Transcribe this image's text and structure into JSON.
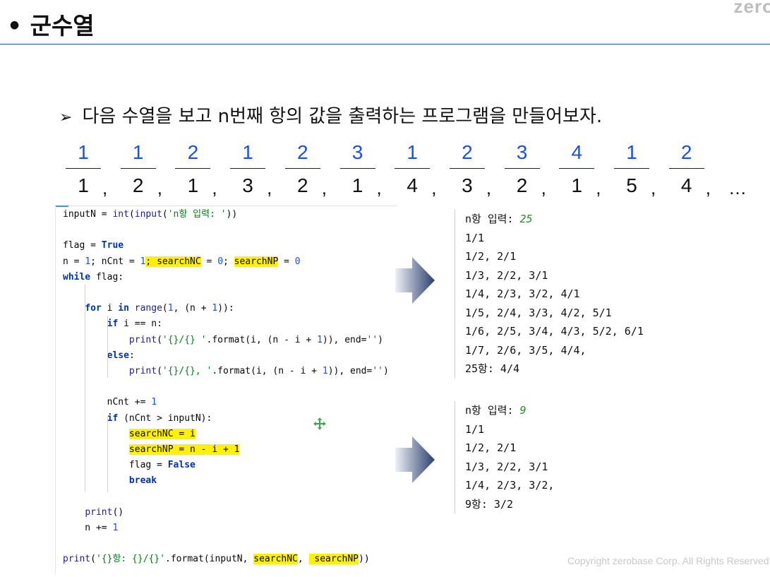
{
  "header": {
    "brand": "zero",
    "title": "• 군수열"
  },
  "bullet": {
    "arrow": "➢",
    "text": "다음 수열을 보고 n번째 항의 값을 출력하는 프로그램을 만들어보자."
  },
  "sequence": {
    "fractions": [
      {
        "num": "1",
        "den": "1"
      },
      {
        "num": "1",
        "den": "2"
      },
      {
        "num": "2",
        "den": "1"
      },
      {
        "num": "1",
        "den": "3"
      },
      {
        "num": "2",
        "den": "2"
      },
      {
        "num": "3",
        "den": "1"
      },
      {
        "num": "1",
        "den": "4"
      },
      {
        "num": "2",
        "den": "3"
      },
      {
        "num": "3",
        "den": "2"
      },
      {
        "num": "4",
        "den": "1"
      },
      {
        "num": "1",
        "den": "5"
      },
      {
        "num": "2",
        "den": "4"
      }
    ],
    "separator": ",",
    "ellipsis": "…"
  },
  "code": {
    "lines": [
      [
        {
          "t": "inputN = "
        },
        {
          "t": "int",
          "c": "fn"
        },
        {
          "t": "("
        },
        {
          "t": "input",
          "c": "fn"
        },
        {
          "t": "("
        },
        {
          "t": "'n항 입력: '",
          "c": "str"
        },
        {
          "t": "))"
        }
      ],
      [],
      [
        {
          "t": "flag = "
        },
        {
          "t": "True",
          "c": "kw"
        }
      ],
      [
        {
          "t": "n = "
        },
        {
          "t": "1",
          "c": "num"
        },
        {
          "t": "; nCnt = "
        },
        {
          "t": "1",
          "c": "num"
        },
        {
          "t": "; ",
          "c": "hl"
        },
        {
          "t": "searchNC",
          "c": "hl"
        },
        {
          "t": " = "
        },
        {
          "t": "0",
          "c": "num"
        },
        {
          "t": "; "
        },
        {
          "t": "searchNP",
          "c": "hl"
        },
        {
          "t": " = "
        },
        {
          "t": "0",
          "c": "num"
        }
      ],
      [
        {
          "t": "while",
          "c": "kw"
        },
        {
          "t": " flag:"
        }
      ],
      [],
      [
        {
          "t": "    "
        },
        {
          "t": "for",
          "c": "kw"
        },
        {
          "t": " i "
        },
        {
          "t": "in",
          "c": "kw"
        },
        {
          "t": " "
        },
        {
          "t": "range",
          "c": "fn"
        },
        {
          "t": "("
        },
        {
          "t": "1",
          "c": "num"
        },
        {
          "t": ", (n + "
        },
        {
          "t": "1",
          "c": "num"
        },
        {
          "t": ")):"
        }
      ],
      [
        {
          "t": "        "
        },
        {
          "t": "if",
          "c": "kw"
        },
        {
          "t": " i == n:"
        }
      ],
      [
        {
          "t": "            "
        },
        {
          "t": "print",
          "c": "fn"
        },
        {
          "t": "("
        },
        {
          "t": "'{}/{} '",
          "c": "str"
        },
        {
          "t": ".format(i, (n - i + "
        },
        {
          "t": "1",
          "c": "num"
        },
        {
          "t": ")), end="
        },
        {
          "t": "''",
          "c": "str"
        },
        {
          "t": ")"
        }
      ],
      [
        {
          "t": "        "
        },
        {
          "t": "else",
          "c": "kw"
        },
        {
          "t": ":"
        }
      ],
      [
        {
          "t": "            "
        },
        {
          "t": "print",
          "c": "fn"
        },
        {
          "t": "("
        },
        {
          "t": "'{}/{}, '",
          "c": "str"
        },
        {
          "t": ".format(i, (n - i + "
        },
        {
          "t": "1",
          "c": "num"
        },
        {
          "t": ")), end="
        },
        {
          "t": "''",
          "c": "str"
        },
        {
          "t": ")"
        }
      ],
      [],
      [
        {
          "t": "        nCnt += "
        },
        {
          "t": "1",
          "c": "num"
        }
      ],
      [
        {
          "t": "        "
        },
        {
          "t": "if",
          "c": "kw"
        },
        {
          "t": " (nCnt > inputN):"
        }
      ],
      [
        {
          "t": "            "
        },
        {
          "t": "searchNC = i",
          "c": "hl"
        }
      ],
      [
        {
          "t": "            "
        },
        {
          "t": "searchNP = n - i + ",
          "c": "hl"
        },
        {
          "t": "1",
          "c": "hl"
        }
      ],
      [
        {
          "t": "            flag = "
        },
        {
          "t": "False",
          "c": "kw"
        }
      ],
      [
        {
          "t": "            "
        },
        {
          "t": "break",
          "c": "kw"
        }
      ],
      [],
      [
        {
          "t": "    "
        },
        {
          "t": "print",
          "c": "fn"
        },
        {
          "t": "()"
        }
      ],
      [
        {
          "t": "    n += "
        },
        {
          "t": "1",
          "c": "num"
        }
      ],
      [],
      [
        {
          "t": "print",
          "c": "fn"
        },
        {
          "t": "("
        },
        {
          "t": "'{}항: {}/{}'",
          "c": "str"
        },
        {
          "t": ".format(inputN, "
        },
        {
          "t": "searchNC",
          "c": "hl"
        },
        {
          "t": ", "
        },
        {
          "t": " searchNP",
          "c": "hl"
        },
        {
          "t": "))"
        }
      ]
    ]
  },
  "outputs": [
    {
      "prompt": "n항 입력: ",
      "input": "25",
      "lines": [
        "1/1",
        "1/2, 2/1",
        "1/3, 2/2, 3/1",
        "1/4, 2/3, 3/2, 4/1",
        "1/5, 2/4, 3/3, 4/2, 5/1",
        "1/6, 2/5, 3/4, 4/3, 5/2, 6/1",
        "1/7, 2/6, 3/5, 4/4,",
        "25항: 4/4"
      ]
    },
    {
      "prompt": "n항 입력: ",
      "input": "9",
      "lines": [
        "1/1",
        "1/2, 2/1",
        "1/3, 2/2, 3/1",
        "1/4, 2/3, 3/2,",
        "9항: 3/2"
      ]
    }
  ],
  "footer": {
    "copyright": "Copyright zerobase Corp. All Rights Reserved"
  },
  "colors": {
    "accent_rule": "#2f4f8f",
    "highlight": "#fff200",
    "arrow_dark": "#2b3f6e"
  }
}
